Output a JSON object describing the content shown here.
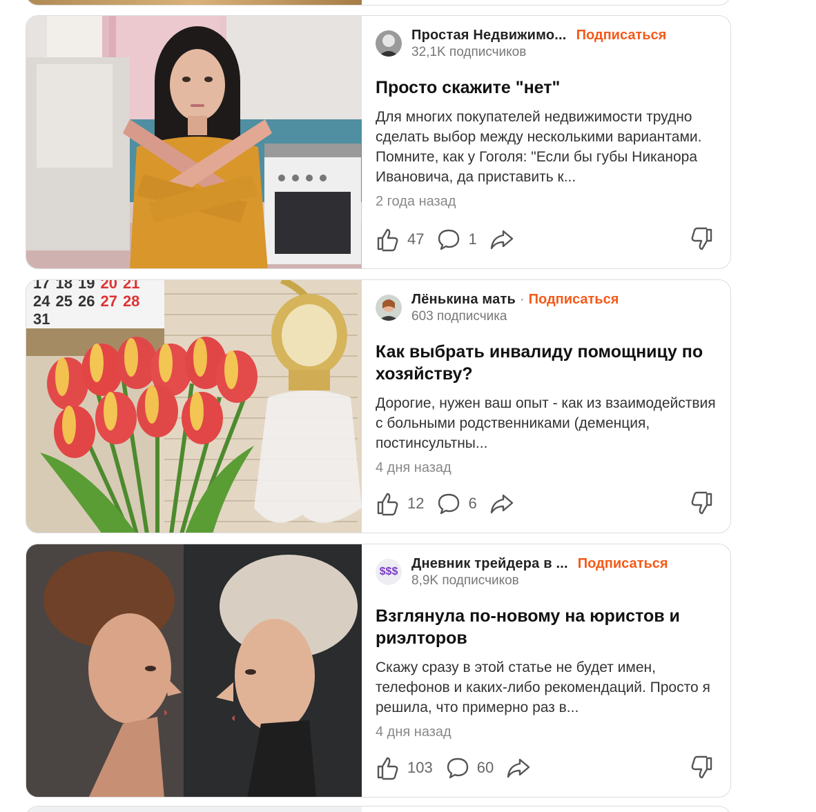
{
  "colors": {
    "accent": "#f45a19",
    "muted": "#888888",
    "border": "#dcdcdc"
  },
  "cards": [
    {
      "author": "Простая Недвижимо...",
      "separator": "",
      "subscribe": "Подписаться",
      "subscribers": "32,1K подписчиков",
      "avatar_icon": "man-avatar",
      "title": "Просто скажите \"нет\"",
      "snippet": "Для многих покупателей недвижимости трудно сделать выбор между несколькими вариантами. Помните, как у Гоголя: \"Если бы губы Никанора Ивановича, да приставить к...",
      "date": "2 года назад",
      "likes": "47",
      "comments": "1",
      "thumbnail": "woman-crossed-arms-kitchen"
    },
    {
      "author": "Лёнькина мать",
      "separator": "·",
      "subscribe": "Подписаться",
      "subscribers": "603 подписчика",
      "avatar_icon": "woman-avatar",
      "title": "Как выбрать инвалиду помощницу по хозяйству?",
      "snippet": "Дорогие, нужен ваш опыт - как из взаимодействия с больными родственниками (деменция, постинсультны...",
      "date": "4 дня назад",
      "likes": "12",
      "comments": "6",
      "thumbnail": "tulips-lamp-calendar",
      "calendar": {
        "row1": [
          "17",
          "18",
          "19",
          "20",
          "21"
        ],
        "row2": [
          "24",
          "25",
          "26",
          "27",
          "28"
        ],
        "row3": [
          "31"
        ]
      }
    },
    {
      "author": "Дневник трейдера в ...",
      "separator": "",
      "subscribe": "Подписаться",
      "subscribers": "8,9K подписчиков",
      "avatar_text": "$$$",
      "title": "Взглянула по-новому на юристов и риэлторов",
      "snippet": "Скажу сразу в этой статье не будет имен, телефонов и каких-либо рекомендаций. Просто я решила, что примерно раз в...",
      "date": "4 дня назад",
      "likes": "103",
      "comments": "60",
      "thumbnail": "two-women-profiles"
    }
  ]
}
